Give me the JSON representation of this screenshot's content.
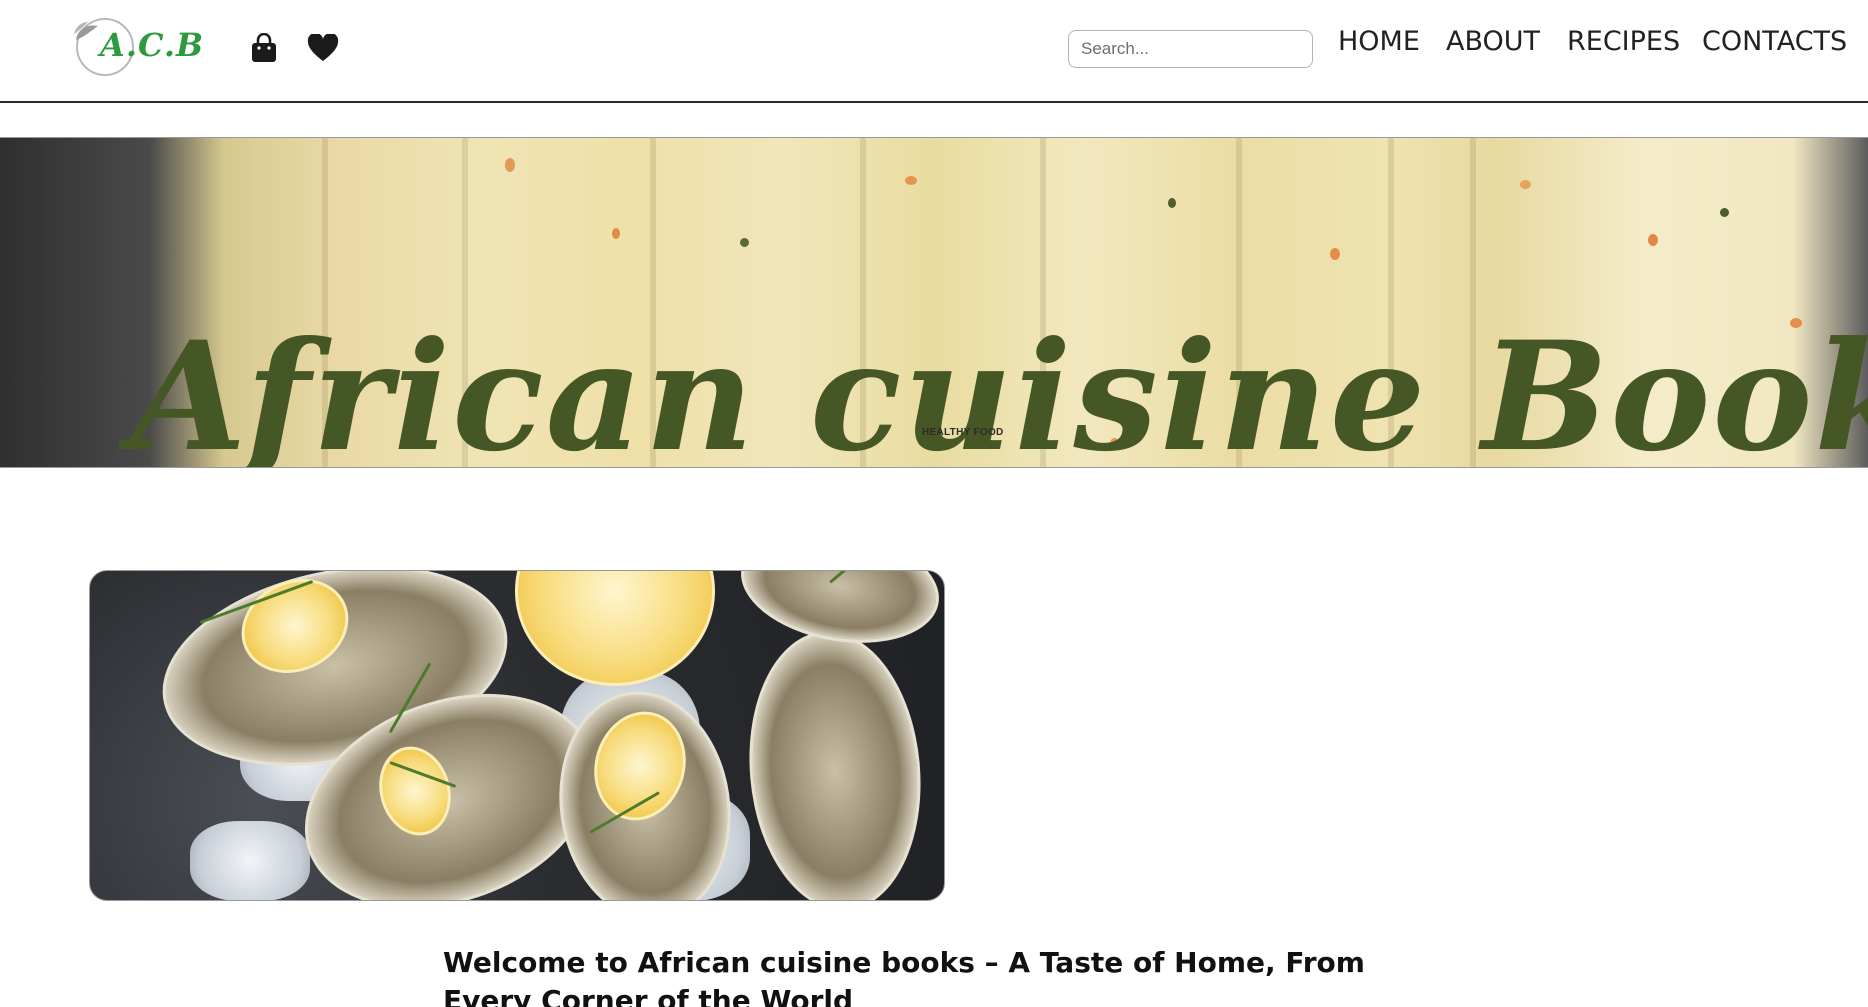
{
  "header": {
    "logo_text": "A.C.B",
    "search_placeholder": "Search...",
    "nav": [
      {
        "label": "HOME"
      },
      {
        "label": "ABOUT"
      },
      {
        "label": "RECIPES"
      },
      {
        "label": "CONTACTS"
      }
    ],
    "icons": [
      "shopping-bag-icon",
      "heart-icon"
    ]
  },
  "banner": {
    "title": "African cuisine Books",
    "subtitle": "HEALTHY FOOD"
  },
  "main": {
    "welcome_heading": "Welcome to African cuisine books – A Taste of Home, From Every Corner of the World"
  },
  "colors": {
    "brand_green": "#2e9a3e",
    "banner_title": "#465726",
    "text": "#111111"
  }
}
